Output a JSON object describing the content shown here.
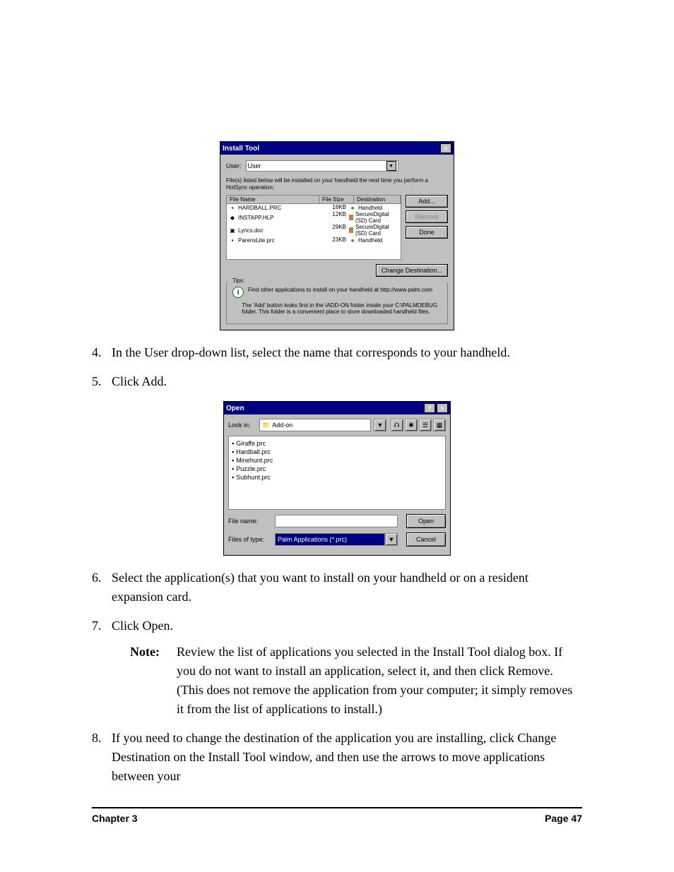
{
  "installTool": {
    "title": "Install Tool",
    "userLabel": "User:",
    "userValue": "User",
    "instruction": "File(s) listed below will be installed on your handheld the next time you perform a HotSync operation:",
    "headers": {
      "filename": "File Name",
      "size": "File Size",
      "dest": "Destination"
    },
    "rows": [
      {
        "name": "HARDBALL.PRC",
        "size": "18KB",
        "dest": "Handheld",
        "destType": "hh"
      },
      {
        "name": "INSTAPP.HLP",
        "size": "12KB",
        "dest": "SecureDigital (SD) Card",
        "destType": "card"
      },
      {
        "name": "Lyrics.doc",
        "size": "29KB",
        "dest": "SecureDigital (SD) Card",
        "destType": "card"
      },
      {
        "name": "ParensLite.prc",
        "size": "23KB",
        "dest": "Handheld",
        "destType": "hh"
      }
    ],
    "buttons": {
      "add": "Add...",
      "remove": "Remove",
      "done": "Done",
      "changeDest": "Change Destination..."
    },
    "tipsLabel": "Tips:",
    "tips": [
      "Find other applications to install on your handheld at http://www.palm.com",
      "The 'Add' button looks first in the \\ADD-ON folder inside your C:\\PALMDEBUG folder. This folder is a convenient place to store downloaded handheld files."
    ]
  },
  "openDialog": {
    "title": "Open",
    "lookInLabel": "Look in:",
    "folderName": "Add-on",
    "files": [
      "Giraffe.prc",
      "Hardball.prc",
      "Minehunt.prc",
      "Puzzle.prc",
      "Subhunt.prc"
    ],
    "fileNameLabel": "File name:",
    "fileNameValue": "",
    "filesOfTypeLabel": "Files of type:",
    "filesOfTypeValue": "Palm Applications (*.prc)",
    "buttons": {
      "open": "Open",
      "cancel": "Cancel"
    }
  },
  "steps": {
    "s4": {
      "num": "4.",
      "text": "In the User drop-down list, select the name that corresponds to your handheld."
    },
    "s5": {
      "num": "5.",
      "text": "Click Add."
    },
    "s6": {
      "num": "6.",
      "text": "Select the application(s) that you want to install on your handheld or on a resident expansion card."
    },
    "s7": {
      "num": "7.",
      "text": "Click Open."
    },
    "noteLabel": "Note:",
    "noteText": "Review the list of applications you selected in the Install Tool dialog box. If you do not want to install an application, select it, and then click Remove. (This does not remove the application from your computer; it simply removes it from the list of applications to install.)",
    "s8": {
      "num": "8.",
      "text": "If you need to change the destination of the application you are installing, click Change Destination on the Install Tool window, and then use the arrows to move applications between your"
    }
  },
  "footer": {
    "left": "Chapter 3",
    "right": "Page 47"
  }
}
